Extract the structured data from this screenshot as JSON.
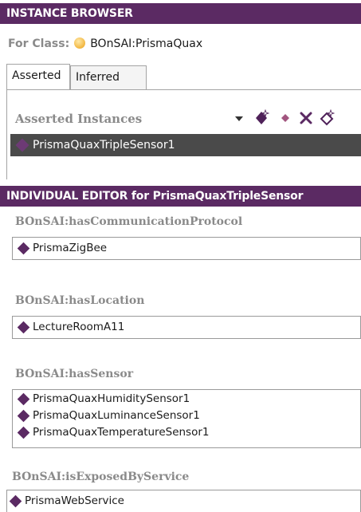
{
  "instance_browser": {
    "title": "INSTANCE BROWSER",
    "for_class_label": "For Class:",
    "for_class_value": "BOnSAI:PrismaQuax",
    "tabs": [
      {
        "label": "Asserted",
        "active": true
      },
      {
        "label": "Inferred",
        "active": false
      }
    ],
    "list_header": "Asserted Instances",
    "toolbar_icons": [
      "dropdown-arrow-icon",
      "add-instance-icon",
      "instance-diamond-icon",
      "delete-instance-icon",
      "edit-instance-icon"
    ],
    "instances": [
      "PrismaQuaxTripleSensor1"
    ]
  },
  "individual_editor": {
    "title": "INDIVIDUAL EDITOR for PrismaQuaxTripleSensor",
    "properties": [
      {
        "label": "BOnSAI:hasCommunicationProtocol",
        "values": [
          "PrismaZigBee"
        ]
      },
      {
        "label": "BOnSAI:hasLocation",
        "values": [
          "LectureRoomA11"
        ]
      },
      {
        "label": "BOnSAI:hasSensor",
        "values": [
          "PrismaQuaxHumiditySensor1",
          "PrismaQuaxLuminanceSensor1",
          "PrismaQuaxTemperatureSensor1"
        ]
      },
      {
        "label": "BOnSAI:isExposedByService",
        "values": [
          "PrismaWebService"
        ]
      }
    ]
  },
  "colors": {
    "title_bar": "#5b2a63",
    "selected_row": "#4a4a4a",
    "diamond": "#5b2a63",
    "class_icon": "#f2b63f",
    "muted_label": "#8a8a8a"
  }
}
